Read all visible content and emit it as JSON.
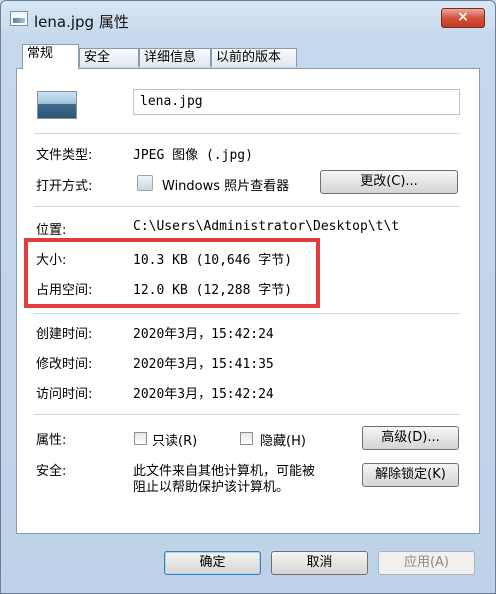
{
  "window": {
    "title": "lena.jpg 属性",
    "close_glyph": "×"
  },
  "tabs": [
    {
      "label": "常规",
      "active": true
    },
    {
      "label": "安全",
      "active": false
    },
    {
      "label": "详细信息",
      "active": false
    },
    {
      "label": "以前的版本",
      "active": false
    }
  ],
  "general": {
    "filename": "lena.jpg",
    "file_type_label": "文件类型:",
    "file_type_value": "JPEG 图像 (.jpg)",
    "open_with_label": "打开方式:",
    "open_with_value": "Windows 照片查看器",
    "change_button": "更改(C)...",
    "location_label": "位置:",
    "location_value": "C:\\Users\\Administrator\\Desktop\\t\\t",
    "size_label": "大小:",
    "size_value": "10.3 KB (10,646 字节)",
    "size_on_disk_label": "占用空间:",
    "size_on_disk_value": "12.0 KB (12,288 字节)",
    "created_label": "创建时间:",
    "created_value": "2020年3月，15:42:24",
    "modified_label": "修改时间:",
    "modified_value": "2020年3月，15:41:35",
    "accessed_label": "访问时间:",
    "accessed_value": "2020年3月，15:42:24",
    "attributes_label": "属性:",
    "readonly_label": "只读(R)",
    "readonly_checked": false,
    "hidden_label": "隐藏(H)",
    "hidden_checked": false,
    "advanced_button": "高级(D)...",
    "security_label": "安全:",
    "security_text_1": "此文件来自其他计算机，可能被",
    "security_text_2": "阻止以帮助保护该计算机。",
    "unblock_button": "解除锁定(K)"
  },
  "footer": {
    "ok_button": "确定",
    "cancel_button": "取消",
    "apply_button": "应用(A)"
  },
  "colors": {
    "highlight_border": "#e53b3b",
    "close_button": "#c13a22"
  }
}
